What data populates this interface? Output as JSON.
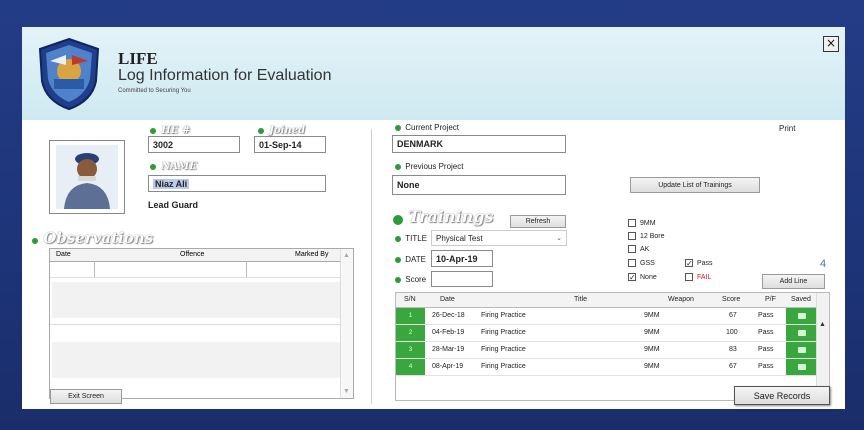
{
  "app": {
    "title": "LIFE",
    "subtitle": "Log Information for Evaluation",
    "tagline": "Committed to Securing You",
    "close_label": "×"
  },
  "profile": {
    "id_label": "HE #",
    "id_value": "3002",
    "joined_label": "Joined",
    "joined_value": "01-Sep-14",
    "name_label": "NAME",
    "name_value": "Niaz Ali",
    "role": "Lead Guard"
  },
  "observations": {
    "title": "Observations",
    "columns": [
      "Date",
      "Offence",
      "Marked By"
    ]
  },
  "exit_button": "Exit Screen",
  "project": {
    "current_label": "Current Project",
    "current_value": "DENMARK",
    "previous_label": "Previous Project",
    "previous_value": "None",
    "print_label": "Print",
    "update_button": "Update List of Trainings"
  },
  "trainings": {
    "title": "Trainings",
    "refresh_button": "Refresh",
    "title_label": "TITLE",
    "title_value": "Physical Test",
    "date_label": "DATE",
    "date_value": "10-Apr-19",
    "score_label": "Score",
    "score_value": "",
    "count": "4",
    "add_line_button": "Add Line",
    "save_button": "Save Records"
  },
  "weapons": [
    {
      "label": "9MM",
      "checked": false
    },
    {
      "label": "12 Bore",
      "checked": false
    },
    {
      "label": "AK",
      "checked": false
    },
    {
      "label": "GSS",
      "checked": false
    },
    {
      "label": "None",
      "checked": true
    }
  ],
  "result": [
    {
      "label": "Pass",
      "checked": true
    },
    {
      "label": "FAIL",
      "checked": false
    }
  ],
  "grid": {
    "columns": [
      "S/N",
      "Date",
      "Title",
      "Weapon",
      "Score",
      "P/F",
      "Saved"
    ],
    "rows": [
      {
        "sn": "1",
        "date": "26-Dec-18",
        "title": "Firing Practice",
        "weapon": "9MM",
        "score": "67",
        "pf": "Pass"
      },
      {
        "sn": "2",
        "date": "04-Feb-19",
        "title": "Firing Practice",
        "weapon": "9MM",
        "score": "100",
        "pf": "Pass"
      },
      {
        "sn": "3",
        "date": "28-Mar-19",
        "title": "Firing Practice",
        "weapon": "9MM",
        "score": "83",
        "pf": "Pass"
      },
      {
        "sn": "4",
        "date": "08-Apr-19",
        "title": "Firing Practice",
        "weapon": "9MM",
        "score": "67",
        "pf": "Pass"
      }
    ]
  },
  "colors": {
    "accent_green": "#3aa63e",
    "header_bg": "#cfe9f1",
    "backdrop": "#1d3478",
    "fail_red": "#d22020",
    "count_blue": "#5a6fb5"
  },
  "icons": [
    "app-logo-icon",
    "close-icon",
    "profile-photo",
    "check-icon",
    "chevron-down-icon",
    "scroll-up-icon",
    "scroll-down-icon"
  ]
}
